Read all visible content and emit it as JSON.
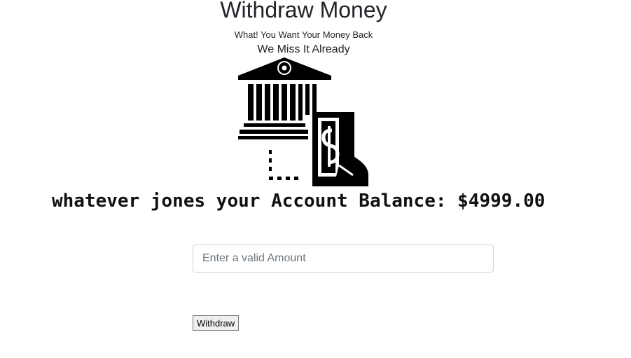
{
  "header": {
    "title": "Withdraw Money",
    "subtitle": "What! You Want Your Money Back",
    "tagline": "We Miss It Already"
  },
  "illustration": {
    "icon": "bank-withdraw-icon"
  },
  "account": {
    "balance_text": "whatever jones your Account Balance: $4999.00"
  },
  "form": {
    "amount_placeholder": "Enter a valid Amount",
    "amount_value": "",
    "withdraw_label": "Withdraw"
  }
}
